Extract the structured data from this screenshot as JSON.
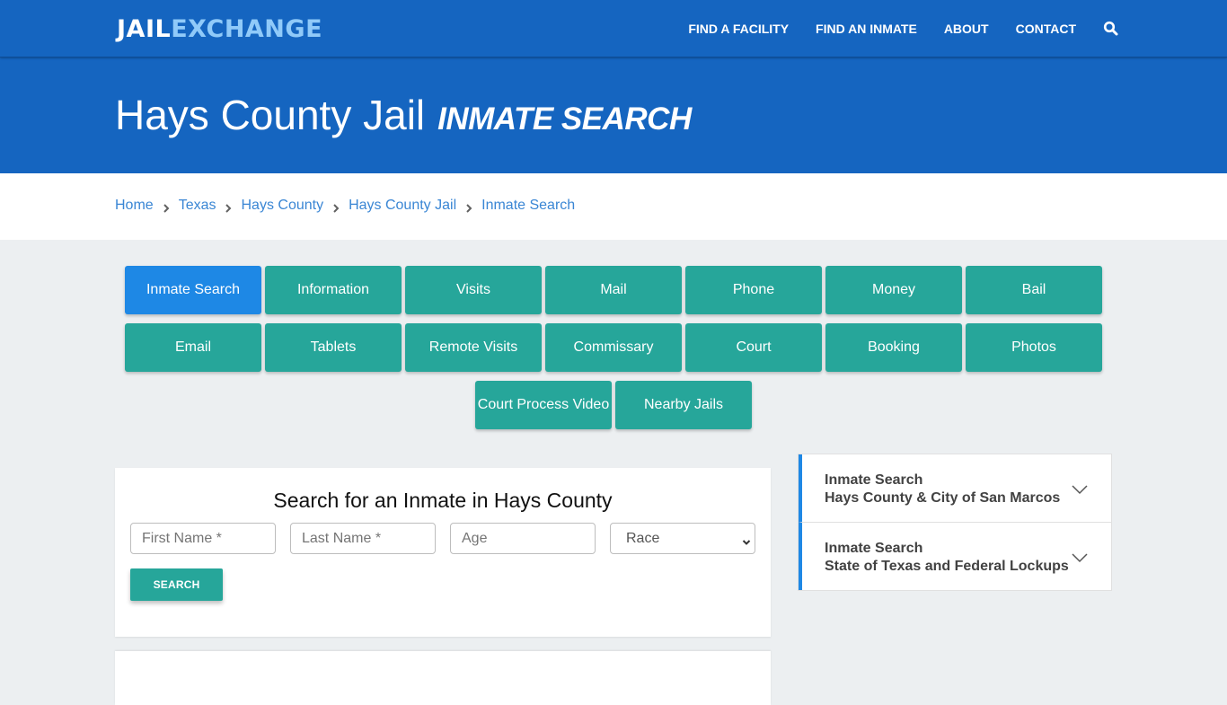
{
  "navbar": {
    "logo": {
      "part1": "JAIL",
      "part2": "EXCHANGE"
    },
    "links": [
      "FIND A FACILITY",
      "FIND AN INMATE",
      "ABOUT",
      "CONTACT"
    ],
    "search_icon": "search-icon"
  },
  "hero": {
    "title": "Hays County Jail",
    "subtitle": "INMATE SEARCH"
  },
  "breadcrumb": [
    "Home",
    "Texas",
    "Hays County",
    "Hays County Jail",
    "Inmate Search"
  ],
  "tabs": {
    "row1": [
      "Inmate Search",
      "Information",
      "Visits",
      "Mail",
      "Phone",
      "Money",
      "Bail"
    ],
    "row2": [
      "Email",
      "Tablets",
      "Remote Visits",
      "Commissary",
      "Court",
      "Booking",
      "Photos"
    ],
    "row3": [
      "Court Process Video",
      "Nearby Jails"
    ],
    "active": "Inmate Search"
  },
  "search_form": {
    "title": "Search for an Inmate in Hays County",
    "first_name_placeholder": "First Name *",
    "last_name_placeholder": "Last Name *",
    "age_placeholder": "Age",
    "race_selected": "Race",
    "submit_label": "SEARCH"
  },
  "accordion": [
    {
      "line1": "Inmate Search",
      "line2": "Hays County & City of San Marcos"
    },
    {
      "line1": "Inmate Search",
      "line2": "State of Texas and Federal Lockups"
    }
  ],
  "colors": {
    "brand_blue": "#1565c0",
    "logo_accent": "#90caf9",
    "teal_button": "#26a69a",
    "active_button": "#1e88e5",
    "link_blue": "#3a86d4",
    "page_background": "#eceff1"
  }
}
